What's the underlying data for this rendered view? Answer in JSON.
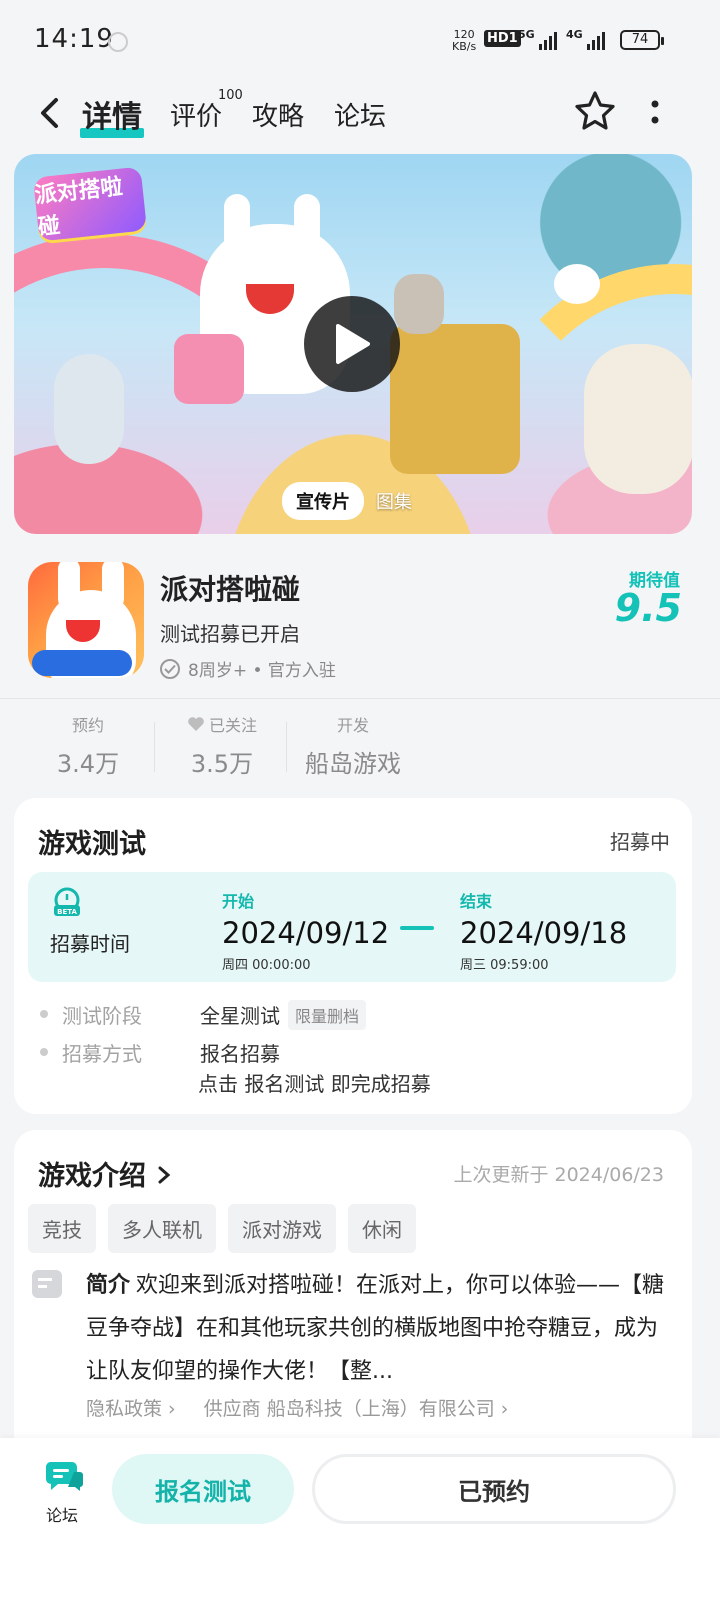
{
  "status_bar": {
    "time": "14:19",
    "net_speed_value": "120",
    "net_speed_unit": "KB/s",
    "hd_badge": "HD1",
    "signal1_label": "5G",
    "signal2_label": "4G",
    "battery": "74"
  },
  "nav": {
    "tabs": [
      {
        "label": "详情",
        "active": true
      },
      {
        "label": "评价",
        "badge": "100"
      },
      {
        "label": "攻略"
      },
      {
        "label": "论坛"
      }
    ]
  },
  "banner": {
    "logo_text": "派对搭啦碰",
    "media_tabs": [
      "宣传片",
      "图集"
    ]
  },
  "game": {
    "title": "派对搭啦碰",
    "subtitle": "测试招募已开启",
    "meta": "8周岁+ • 官方入驻",
    "expect_label": "期待值",
    "expect_score": "9.5"
  },
  "stats": [
    {
      "label": "预约",
      "value": "3.4万"
    },
    {
      "label": "已关注",
      "value": "3.5万"
    },
    {
      "label": "开发",
      "value": "船岛游戏"
    }
  ],
  "test_card": {
    "title": "游戏测试",
    "status": "招募中",
    "recruit_label": "招募时间",
    "start": {
      "head": "开始",
      "date": "2024/09/12",
      "sub": "周四  00:00:00"
    },
    "end": {
      "head": "结束",
      "date": "2024/09/18",
      "sub": "周三  09:59:00"
    },
    "phase_key": "测试阶段",
    "phase_value": "全星测试",
    "phase_chip": "限量删档",
    "method_key": "招募方式",
    "method_value": "报名招募",
    "method_note": "点击 报名测试 即完成招募"
  },
  "intro_card": {
    "title": "游戏介绍",
    "updated": "上次更新于 2024/06/23",
    "tags": [
      "竞技",
      "多人联机",
      "派对游戏",
      "休闲"
    ],
    "intro_label": "简介",
    "intro_text": "欢迎来到派对搭啦碰！在派对上，你可以体验——【糖豆争夺战】在和其他玩家共创的横版地图中抢夺糖豆，成为让队友仰望的操作大佬！【整...",
    "privacy": "隐私政策",
    "supplier": "供应商 船岛科技（上海）有限公司"
  },
  "bottom_bar": {
    "forum_label": "论坛",
    "signup_label": "报名测试",
    "reserved_label": "已预约"
  },
  "colors": {
    "accent": "#14c2b8",
    "accent_light": "#e5f8f7",
    "page_bg": "#f4f5f7"
  }
}
